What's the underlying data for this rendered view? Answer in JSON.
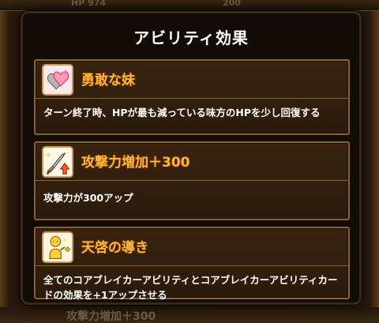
{
  "background": {
    "top_left_text": "HP 974",
    "top_right_text": "200",
    "bottom_text": "攻撃力増加＋300"
  },
  "dialog": {
    "title": "アビリティ効果",
    "abilities": [
      {
        "name": "勇敢な妹",
        "icon": "heart-icon",
        "description": "ターン終了時、HPが最も減っている味方のHPを少し回復する"
      },
      {
        "name": "攻撃力増加＋300",
        "icon": "sword-attack-up-icon",
        "description": "攻撃力が300アップ"
      },
      {
        "name": "天啓の導き",
        "icon": "guide-figure-icon",
        "description": "全てのコアブレイカーアビリティとコアブレイカーアビリティカードの効果を+1アップさせる"
      }
    ]
  },
  "colors": {
    "name_gold": "#ffb83a",
    "card_border": "#8a6330",
    "dialog_bg": "#120b06"
  }
}
